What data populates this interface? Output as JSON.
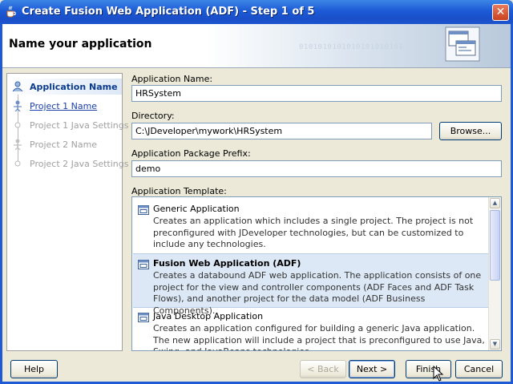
{
  "window": {
    "title": "Create Fusion Web Application (ADF) - Step 1 of 5",
    "close_icon": "close-x"
  },
  "header": {
    "title": "Name your application",
    "binary_text": "0101010101010101010101"
  },
  "steps": [
    {
      "label": "Application Name",
      "state": "current"
    },
    {
      "label": "Project 1 Name",
      "state": "link"
    },
    {
      "label": "Project 1 Java Settings",
      "state": "disabled"
    },
    {
      "label": "Project 2 Name",
      "state": "disabled"
    },
    {
      "label": "Project 2 Java Settings",
      "state": "disabled"
    }
  ],
  "form": {
    "app_name_label": "Application Name:",
    "app_name_value": "HRSystem",
    "directory_label": "Directory:",
    "directory_value": "C:\\JDeveloper\\mywork\\HRSystem",
    "browse_label": "Browse...",
    "package_prefix_label": "Application Package Prefix:",
    "package_prefix_value": "demo",
    "template_label": "Application Template:"
  },
  "templates": [
    {
      "name": "Generic Application",
      "description": "Creates an application which includes a single project. The project is not preconfigured with JDeveloper technologies, but can be customized to include any technologies.",
      "selected": false
    },
    {
      "name": "Fusion Web Application (ADF)",
      "description": "Creates a databound ADF web application. The application consists of one project for the view and controller components (ADF Faces and ADF Task Flows), and another project for the data model (ADF Business Components).",
      "selected": true
    },
    {
      "name": "Java Desktop Application",
      "description": "Creates an application configured for building a generic Java application. The new application will include a project that is preconfigured to use Java, Swing, and JavaBeans technologies.",
      "selected": false
    }
  ],
  "buttons": {
    "help": "Help",
    "back": "< Back",
    "next": "Next >",
    "finish": "Finish",
    "cancel": "Cancel"
  },
  "colors": {
    "titlebar": "#1c5ad6",
    "selected_row": "#dce8f6",
    "current_step_text": "#0b3b8c",
    "link_text": "#1a3fa6"
  }
}
